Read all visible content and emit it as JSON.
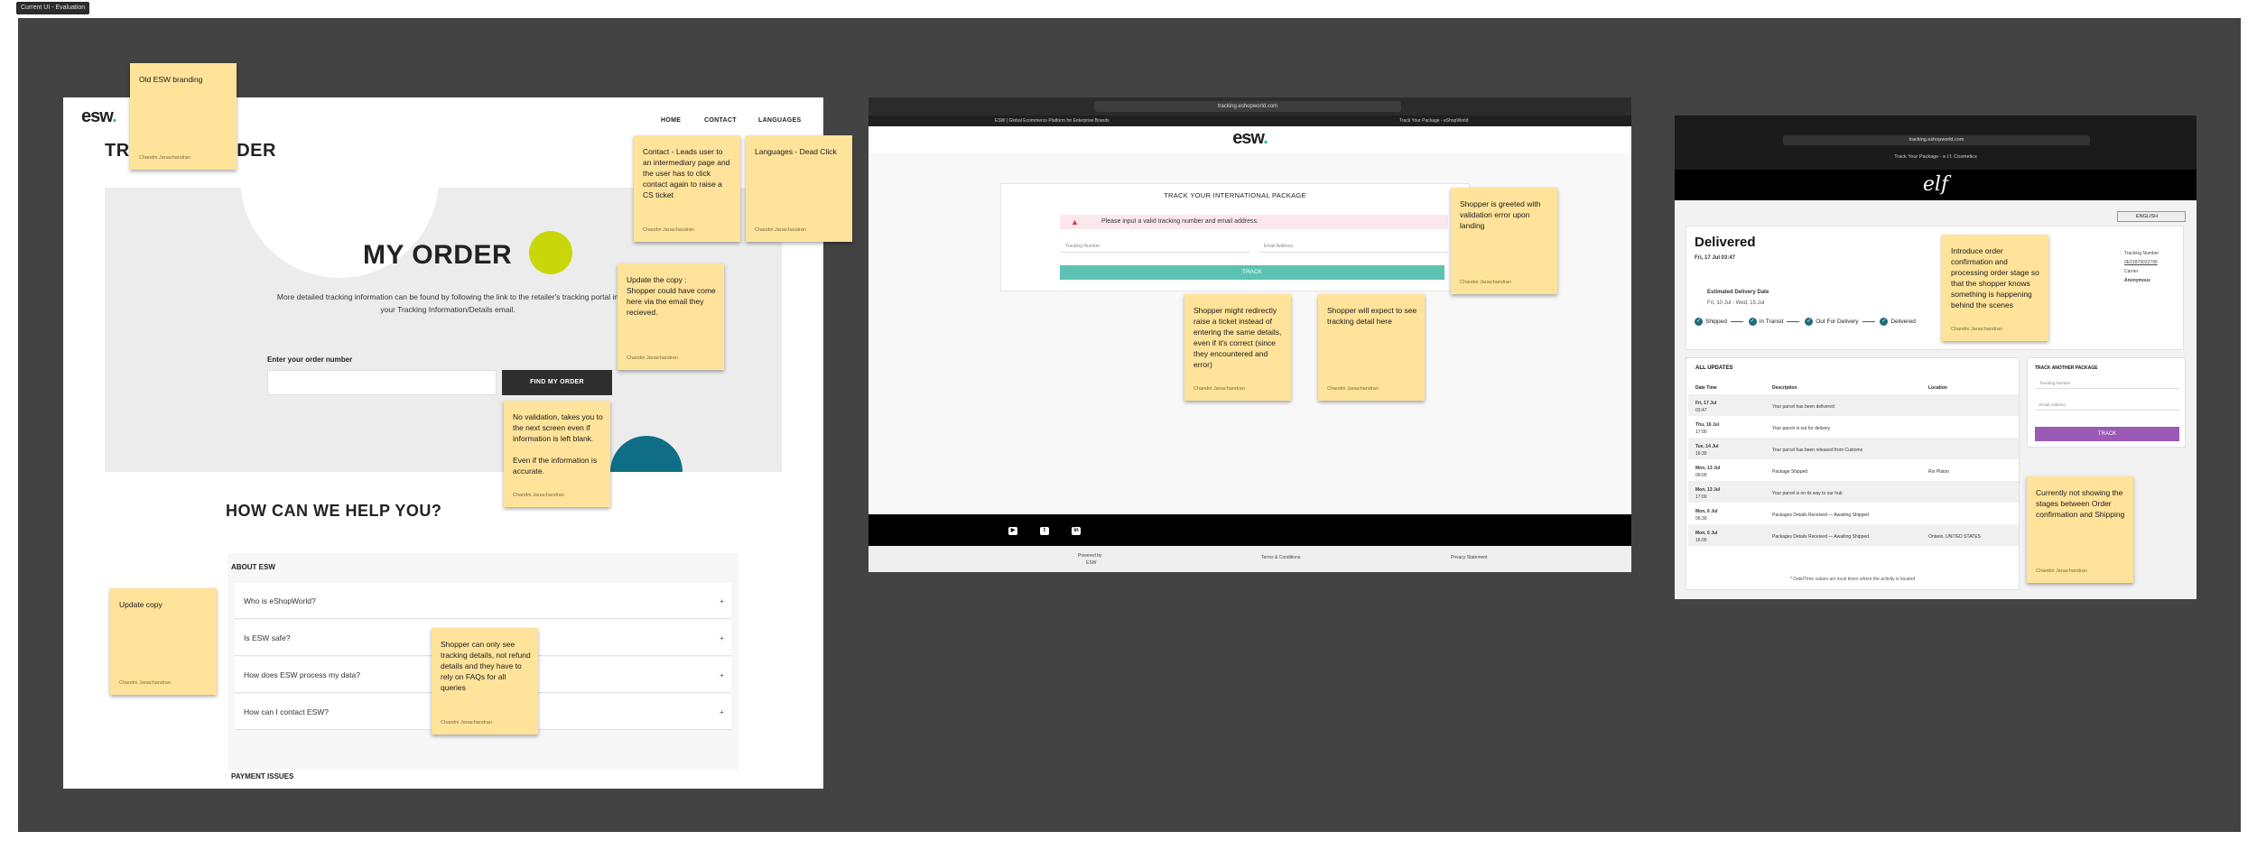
{
  "frame_label": "Current UI - Evaluation",
  "screen1": {
    "logo": "esw",
    "nav": [
      "HOME",
      "CONTACT",
      "LANGUAGES"
    ],
    "page_title": "TRACK MY ORDER",
    "hero_title": "MY ORDER",
    "description": "More detailed tracking information can be found by following the link to the retailer's tracking portal in your Tracking Information/Details email.",
    "order_label": "Enter your order number",
    "order_button": "FIND MY ORDER",
    "help_title": "HOW CAN WE HELP YOU?",
    "about_title": "ABOUT ESW",
    "faqs": [
      "Who is eShopWorld?",
      "Is ESW safe?",
      "How does ESW process my data?",
      "How can I contact ESW?"
    ],
    "faq_plus": "+",
    "payment_title": "PAYMENT ISSUES"
  },
  "screen2": {
    "url": "tracking.eshopworld.com",
    "tab_left": "ESW | Global Ecommerce Platform for Enterprise Brands",
    "tab_right": "Track Your Package - eShopWorld",
    "logo": "esw",
    "card_title": "TRACK YOUR INTERNATIONAL PACKAGE",
    "error_message": "Please input a valid tracking number and email address.",
    "tracking_placeholder": "Tracking Number",
    "email_placeholder": "Email Address",
    "track_button": "TRACK",
    "social": [
      "▶",
      "t",
      "in"
    ],
    "footer_powered": "Powered by",
    "footer_esw": "ESW",
    "footer_terms": "Terms & Conditions",
    "footer_privacy": "Privacy Statement"
  },
  "screen3": {
    "url": "tracking.eshopworld.com",
    "tab": "Track Your Package - e.l.f. Cosmetics",
    "brand": "elf",
    "language": "ENGLISH",
    "status": "Delivered",
    "status_date": "Fri, 17 Jul 03:47",
    "est_label": "Estimated Delivery Date",
    "est_value": "Fri, 10 Jul - Wed, 15 Jul",
    "steps": [
      "Shipped",
      "In Transit",
      "Out For Delivery",
      "Delivered"
    ],
    "side_info": [
      "Tracking Number",
      "0E01879032799",
      "Carrier",
      "Anonymous"
    ],
    "updates_title": "ALL UPDATES",
    "columns": [
      "Date Time",
      "Description",
      "Location"
    ],
    "rows": [
      {
        "date": "Fri, 17 Jul",
        "time": "03:47",
        "desc": "Your parcel has been delivered",
        "loc": ""
      },
      {
        "date": "Thu, 16 Jul",
        "time": "17:00",
        "desc": "Your parcel is out for delivery",
        "loc": ""
      },
      {
        "date": "Tue, 14 Jul",
        "time": "16:30",
        "desc": "Your parcel has been released from Customs",
        "loc": ""
      },
      {
        "date": "Mon, 13 Jul",
        "time": "09:00",
        "desc": "Package Shipped",
        "loc": "Roi Platon"
      },
      {
        "date": "Mon, 13 Jul",
        "time": "17:00",
        "desc": "Your parcel is on its way to our hub",
        "loc": ""
      },
      {
        "date": "Mon, 6 Jul",
        "time": "06:30",
        "desc": "Packages Details Received — Awaiting Shipped",
        "loc": ""
      },
      {
        "date": "Mon, 6 Jul",
        "time": "16:00",
        "desc": "Packages Details Received — Awaiting Shipped",
        "loc": "Ontario, UNITED STATES"
      }
    ],
    "footnote": "* Date/Time values are local times where the activity is located",
    "another_title": "TRACK ANOTHER PACKAGE",
    "another_tracking": "Tracking Number",
    "another_email": "Email Address",
    "another_button": "TRACK"
  },
  "stickies": [
    {
      "text": "Old ESW branding",
      "author": "Chandni Janachandran"
    },
    {
      "text": "Contact - Leads user to an intermediary page and the user has to click contact again to raise a CS ticket",
      "author": "Chandni Janachandran"
    },
    {
      "text": "Languages - Dead Click",
      "author": "Chandni Janachandran"
    },
    {
      "text": "Update the copy : Shopper could have come here via the email they recieved.",
      "author": "Chandni Janachandran"
    },
    {
      "text": "No validation, takes you to the next screen even if information is left blank.\n\nEven if the information is accurate.",
      "author": "Chandni Janachandran"
    },
    {
      "text": "Update copy",
      "author": "Chandni Janachandran"
    },
    {
      "text": "Shopper can only see tracking details, not refund details and they have to rely on FAQs for all queries",
      "author": "Chandni Janachandran"
    },
    {
      "text": "Shopper is greeted with validation error upon landing",
      "author": "Chandni Janachandran"
    },
    {
      "text": "Shopper might redirectly raise a ticket instead of entering the same details, even if it's correct (since they encountered and error)",
      "author": "Chandni Janachandran"
    },
    {
      "text": "Shopper will expect to see tracking detail here",
      "author": "Chandni Janachandran"
    },
    {
      "text": "Introduce order confirmation and processing order stage so that the shopper knows something is happening behind the scenes",
      "author": "Chandni Janachandran"
    },
    {
      "text": "Currently not showing the stages between Order confirmation and Shipping",
      "author": "Chandni Janachandran"
    }
  ],
  "colors": {
    "canvas": "#434343",
    "sticky": "#ffe39a",
    "esw_teal": "#5cc2b2",
    "elf_purple": "#9b59b6",
    "lime": "#c9d60a"
  }
}
